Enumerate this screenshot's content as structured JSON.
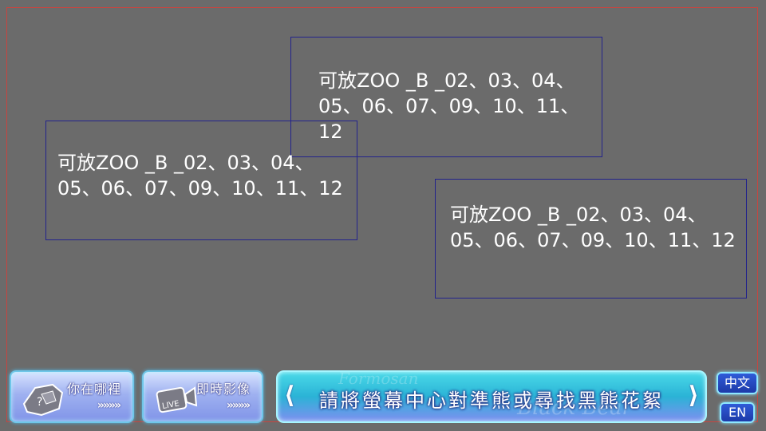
{
  "placeholders": [
    {
      "text": "可放ZOO _B _02、03、04、05、06、07、09、10、11、12"
    },
    {
      "text": "可放ZOO _B _02、03、04、05、06、07、09、10、11、12"
    },
    {
      "text": "可放ZOO _B _02、03、04、05、06、07、09、10、11、12"
    }
  ],
  "bottom_bar": {
    "where_button": {
      "label": "你在哪裡",
      "arrows": "»»»»",
      "icon_mark": "?"
    },
    "live_button": {
      "label": "即時影像",
      "arrows": "»»»»",
      "icon_mark": "LIVE"
    },
    "instruction": {
      "text": "請將螢幕中心對準熊或尋找黑熊花絮",
      "watermark": "Black Bear",
      "watermark_top": "Formosan"
    },
    "language": {
      "zh": "中文",
      "en": "EN"
    }
  },
  "colors": {
    "background": "#6b6b6b",
    "safe_frame": "#c8453f",
    "placeholder_border": "#23238c",
    "banner": "#2bb3d6",
    "nav_button": "#9fb1f0",
    "language_button": "#1d3aa8"
  }
}
